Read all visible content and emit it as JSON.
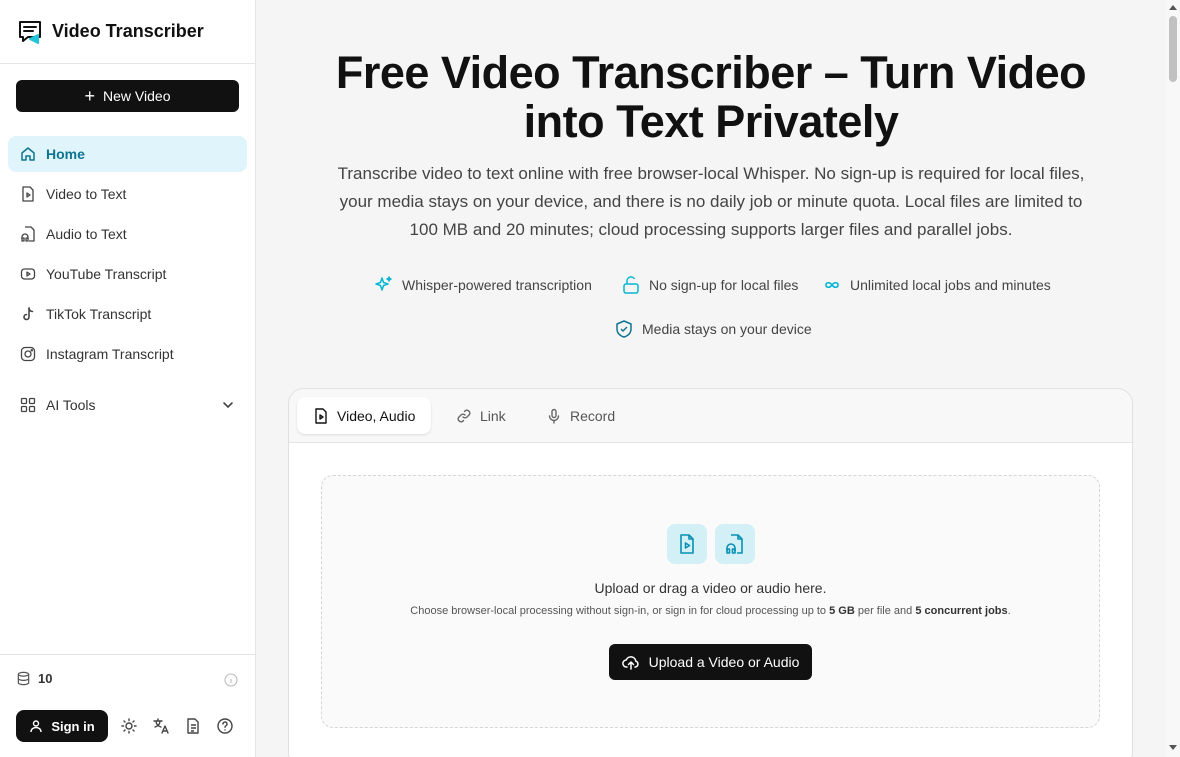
{
  "brand": {
    "name": "Video Transcriber"
  },
  "sidebar": {
    "new_button": "New Video",
    "items": [
      {
        "label": "Home",
        "icon": "home-icon"
      },
      {
        "label": "Video to Text",
        "icon": "file-video-icon"
      },
      {
        "label": "Audio to Text",
        "icon": "file-audio-icon"
      },
      {
        "label": "YouTube Transcript",
        "icon": "youtube-icon"
      },
      {
        "label": "TikTok Transcript",
        "icon": "tiktok-icon"
      },
      {
        "label": "Instagram Transcript",
        "icon": "instagram-icon"
      }
    ],
    "ai_tools": "AI Tools",
    "credits": "10",
    "signin": "Sign in"
  },
  "hero": {
    "title": "Free Video Transcriber – Turn Video into Text Privately",
    "subtitle": "Transcribe video to text online with free browser-local Whisper. No sign-up is required for local files, your media stays on your device, and there is no daily job or minute quota. Local files are limited to 100 MB and 20 minutes; cloud processing supports larger files and parallel jobs.",
    "features": [
      "Whisper-powered transcription",
      "No sign-up for local files",
      "Unlimited local jobs and minutes",
      "Media stays on your device"
    ]
  },
  "tabs": [
    "Video, Audio",
    "Link",
    "Record"
  ],
  "upload": {
    "title": "Upload or drag a video or audio here.",
    "sub_prefix": "Choose browser-local processing without sign-in, or sign in for cloud processing up to ",
    "sub_size": "5 GB",
    "sub_mid": " per file and ",
    "sub_jobs": "5 concurrent jobs",
    "sub_end": ".",
    "button": "Upload a Video or Audio"
  },
  "colors": {
    "accent": "#0e7490",
    "accent_bg": "#e0f5fb",
    "icon_teal": "#06b6d4",
    "dark": "#111111"
  }
}
